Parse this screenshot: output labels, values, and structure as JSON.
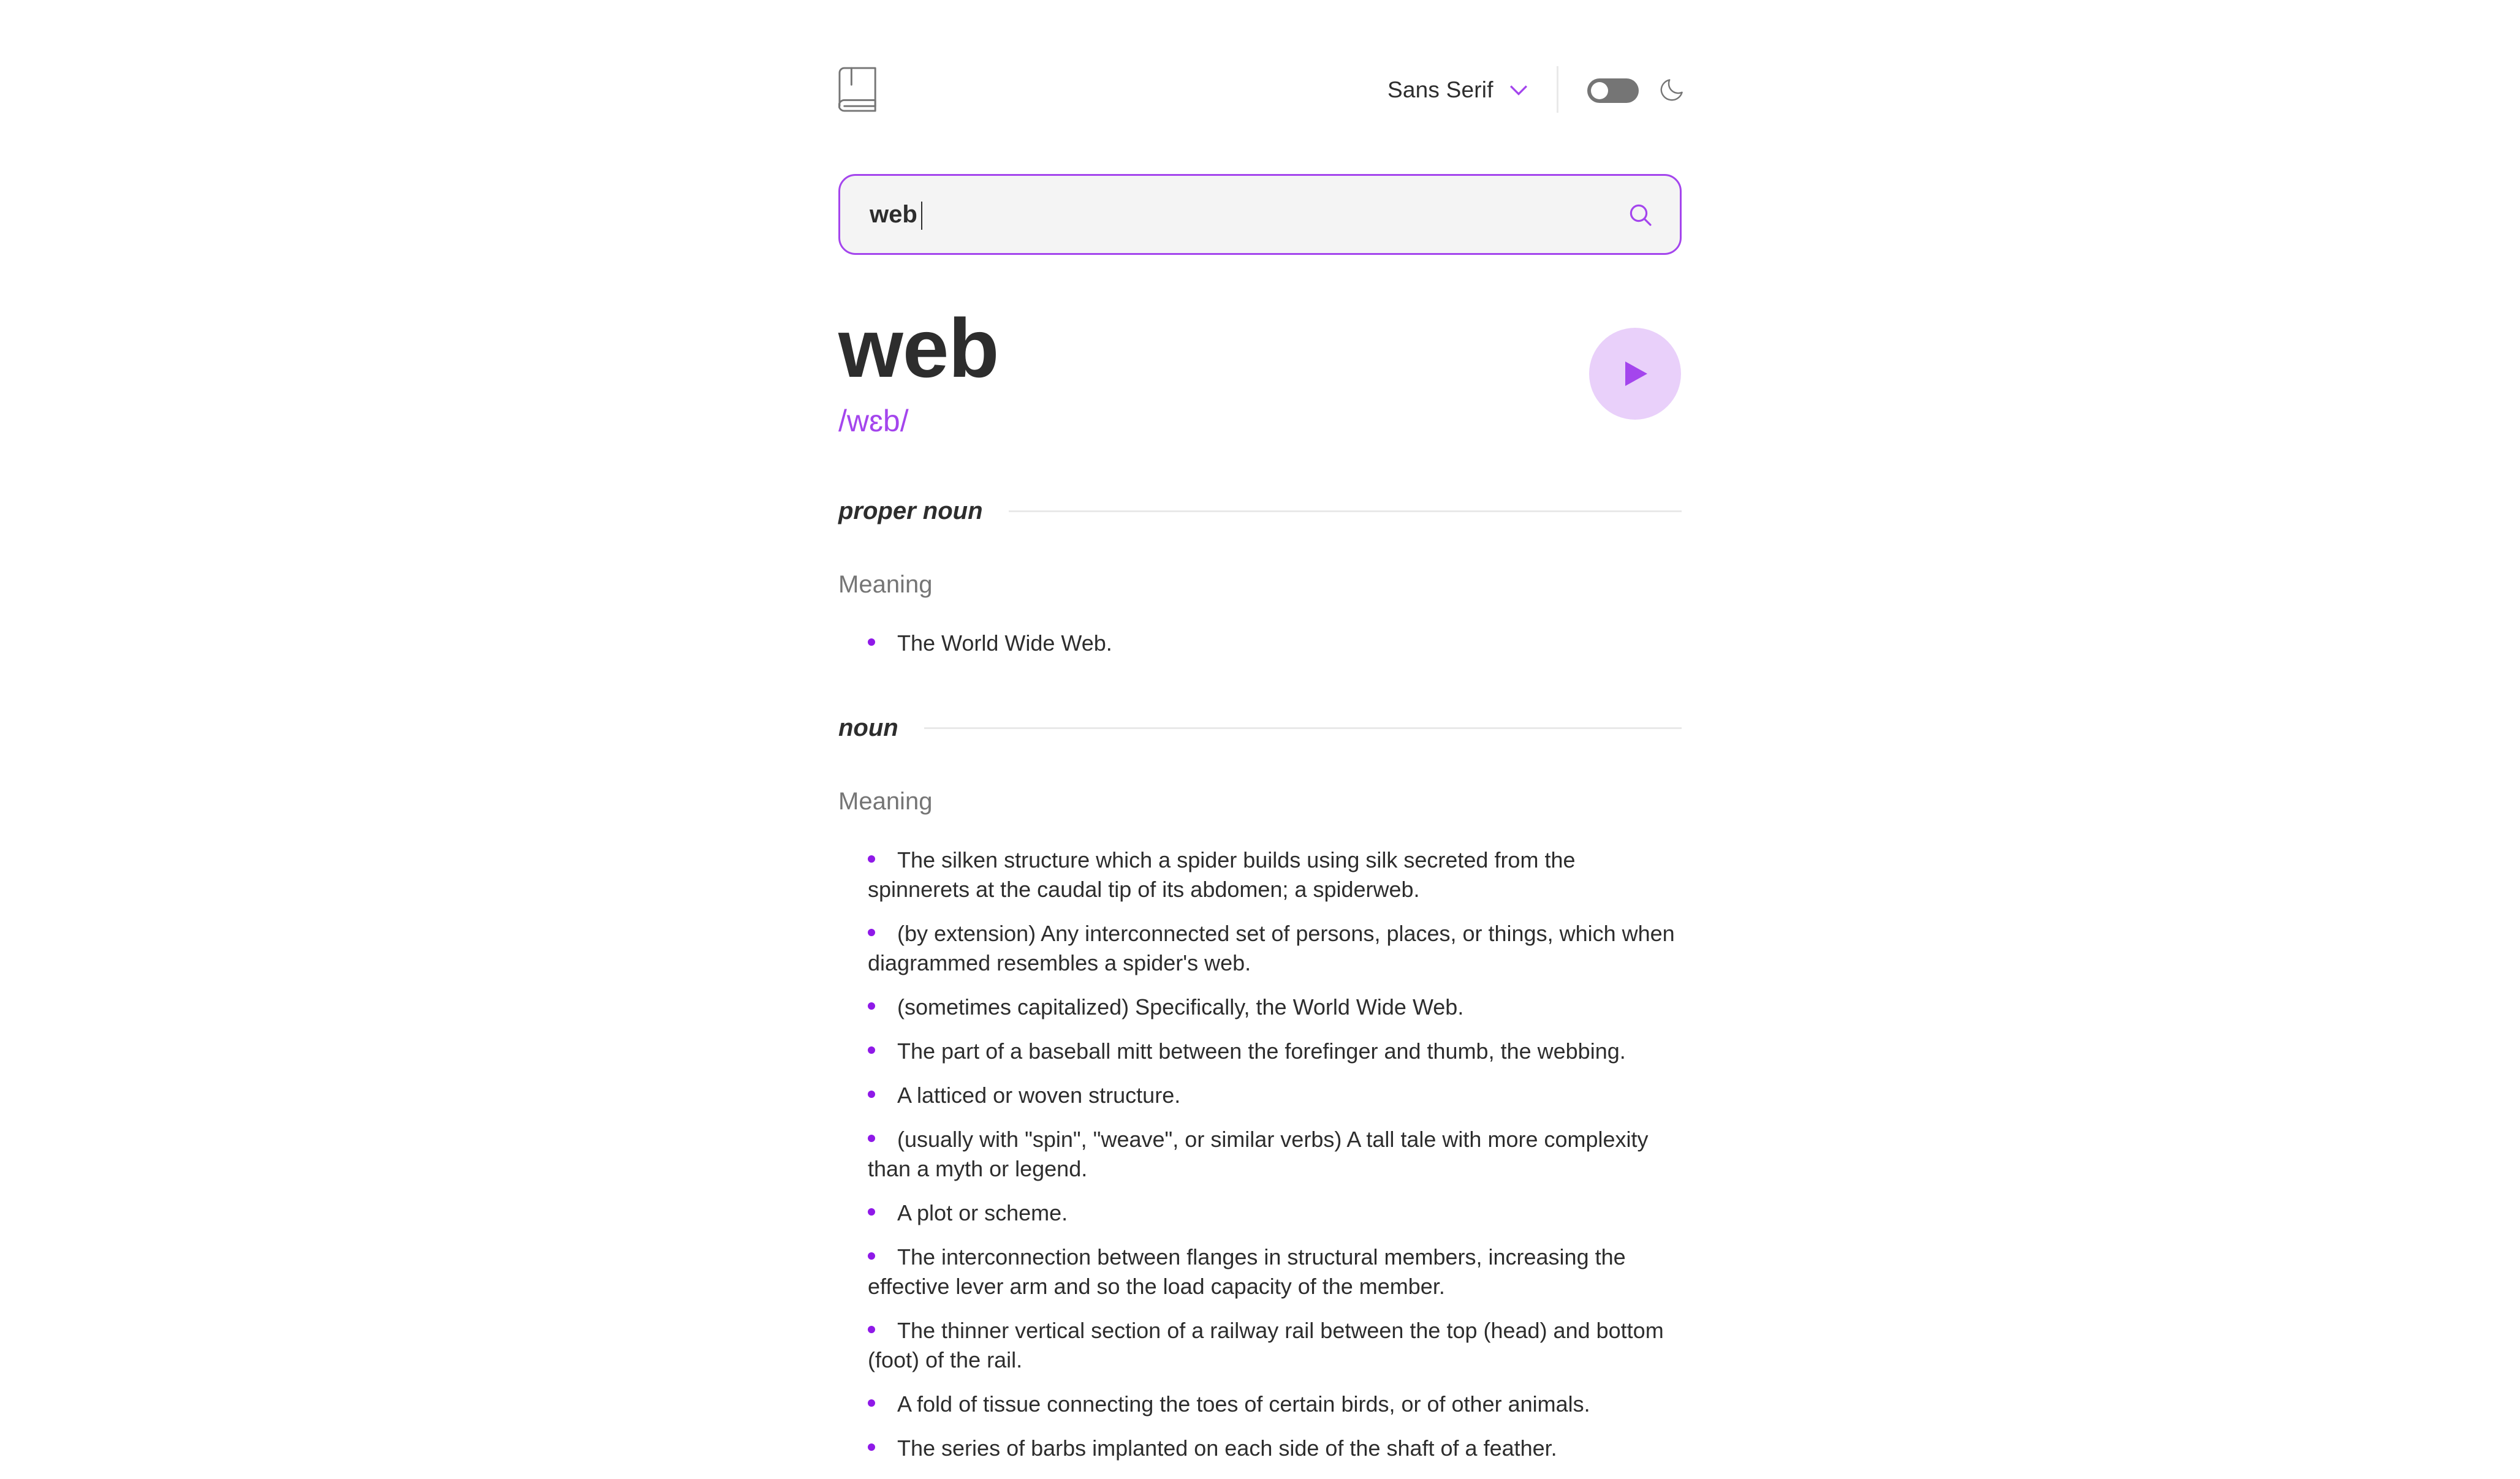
{
  "header": {
    "font_label": "Sans Serif",
    "logo_icon": "book-icon",
    "theme_icon": "moon-icon",
    "dark_mode_enabled": false
  },
  "search": {
    "value": "web",
    "placeholder": "",
    "icon": "search-icon"
  },
  "word": {
    "text": "web",
    "phonetic": "/wɛb/",
    "play_icon": "play-icon"
  },
  "meanings": [
    {
      "part_of_speech": "proper noun",
      "label": "Meaning",
      "definitions": [
        "The World Wide Web."
      ]
    },
    {
      "part_of_speech": "noun",
      "label": "Meaning",
      "definitions": [
        "The silken structure which a spider builds using silk secreted from the spinnerets at the caudal tip of its abdomen; a spiderweb.",
        "(by extension) Any interconnected set of persons, places, or things, which when diagrammed resembles a spider's web.",
        "(sometimes capitalized) Specifically, the World Wide Web.",
        "The part of a baseball mitt between the forefinger and thumb, the webbing.",
        "A latticed or woven structure.",
        "(usually with \"spin\", \"weave\", or similar verbs) A tall tale with more complexity than a myth or legend.",
        "A plot or scheme.",
        "The interconnection between flanges in structural members, increasing the effective lever arm and so the load capacity of the member.",
        "The thinner vertical section of a railway rail between the top (head) and bottom (foot) of the rail.",
        "A fold of tissue connecting the toes of certain birds, or of other animals.",
        "The series of barbs implanted on each side of the shaft of a feather."
      ]
    }
  ],
  "colors": {
    "accent": "#a445ed",
    "accent_light": "#e9d0fa",
    "text": "#2d2d2d",
    "muted": "#757575",
    "divider": "#e9e9e9"
  }
}
